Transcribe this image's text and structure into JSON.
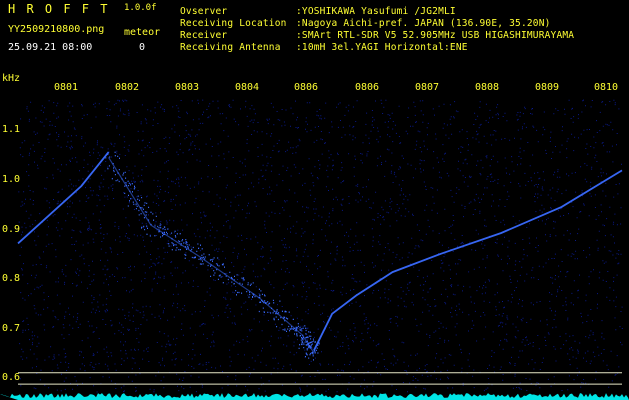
{
  "app": {
    "logo": "H R O F F T",
    "version": "1.0.0f",
    "filename": "YY2509210800.png",
    "meteor_label": "meteor",
    "meteor_count": "0",
    "datetime": "25.09.21 08:00"
  },
  "info": {
    "observer_label": "Ovserver",
    "observer_value": ":YOSHIKAWA Yasufumi /JG2MLI",
    "location_label": "Receiving Location",
    "location_value": ":Nagoya Aichi-pref. JAPAN (136.90E, 35.20N)",
    "receiver_label": "Receiver",
    "receiver_value": ":SMArt RTL-SDR V5 52.905MHz USB HIGASHIMURAYAMA",
    "antenna_label": "Receiving Antenna",
    "antenna_value": ":10mH 3el.YAGI Horizontal:ENE"
  },
  "chart_data": {
    "type": "scatter",
    "ylabel": "kHz",
    "time_ticks": [
      "0801",
      "0802",
      "0803",
      "0804",
      "0806",
      "0806",
      "0807",
      "0808",
      "0809",
      "0810"
    ],
    "freq_ticks": [
      "1.1",
      "1.0",
      "0.9",
      "0.8",
      "0.7",
      "0.6"
    ],
    "ylim": [
      0.58,
      1.14
    ],
    "xlim": [
      0,
      10
    ],
    "series": [
      {
        "x": [
          0.0,
          1.05,
          1.5
        ],
        "y": [
          0.865,
          0.975,
          1.04
        ]
      },
      {
        "x": [
          1.5,
          2.2,
          3.0,
          4.0,
          4.7,
          4.9
        ],
        "y": [
          1.03,
          0.9,
          0.84,
          0.76,
          0.69,
          0.655
        ]
      },
      {
        "x": [
          4.9,
          5.2,
          5.6,
          6.2,
          7.0,
          8.0,
          9.0,
          10.0
        ],
        "y": [
          0.66,
          0.73,
          0.765,
          0.81,
          0.845,
          0.885,
          0.935,
          1.005
        ]
      }
    ],
    "reference_lines": [
      0.617,
      0.595
    ],
    "colors": {
      "signal": "#3a6bff",
      "noise": "#0a1a8a",
      "ref": "#e8e8c8",
      "floor": "#00e5e5",
      "text": "#ffff33"
    }
  }
}
